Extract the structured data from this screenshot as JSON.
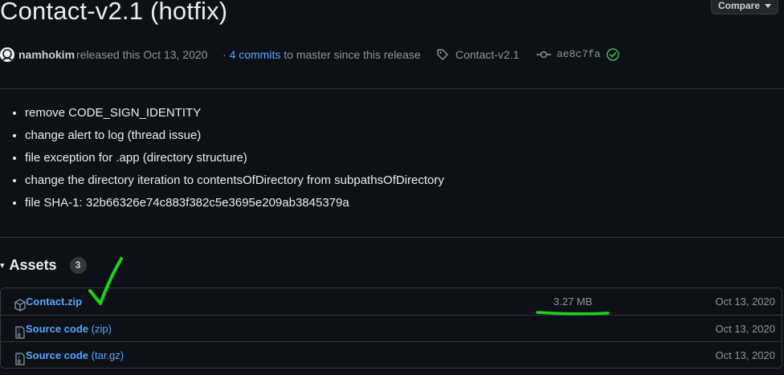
{
  "release": {
    "title": "Contact-v2.1 (hotfix)",
    "compare_label": "Compare",
    "author": "namhokim",
    "released_text": "released this Oct 13, 2020",
    "commits_prefix": "·",
    "commits_link": "4 commits",
    "commits_suffix": "to master since this release",
    "tag": "Contact-v2.1",
    "commit_sha": "ae8c7fa"
  },
  "notes": [
    "remove CODE_SIGN_IDENTITY",
    "change alert to log (thread issue)",
    "file exception for .app (directory structure)",
    "change the directory iteration to contentsOfDirectory from subpathsOfDirectory",
    "file SHA-1: 32b66326e74c883f382c5e3695e209ab3845379a"
  ],
  "assets": {
    "title": "Assets",
    "toggle": "▾",
    "count": "3",
    "items": [
      {
        "name": "Contact.zip",
        "suffix": "",
        "size": "3.27 MB",
        "date": "Oct 13, 2020",
        "icon": "package-icon"
      },
      {
        "name": "Source code",
        "suffix": "(zip)",
        "size": "",
        "date": "Oct 13, 2020",
        "icon": "file-zip-icon"
      },
      {
        "name": "Source code",
        "suffix": "(tar.gz)",
        "size": "",
        "date": "Oct 13, 2020",
        "icon": "file-zip-icon"
      }
    ]
  },
  "colors": {
    "background": "#0d1117",
    "link": "#58a6ff",
    "muted": "#8b949e",
    "annotation": "#1fd11f",
    "verified": "#3fb950"
  }
}
